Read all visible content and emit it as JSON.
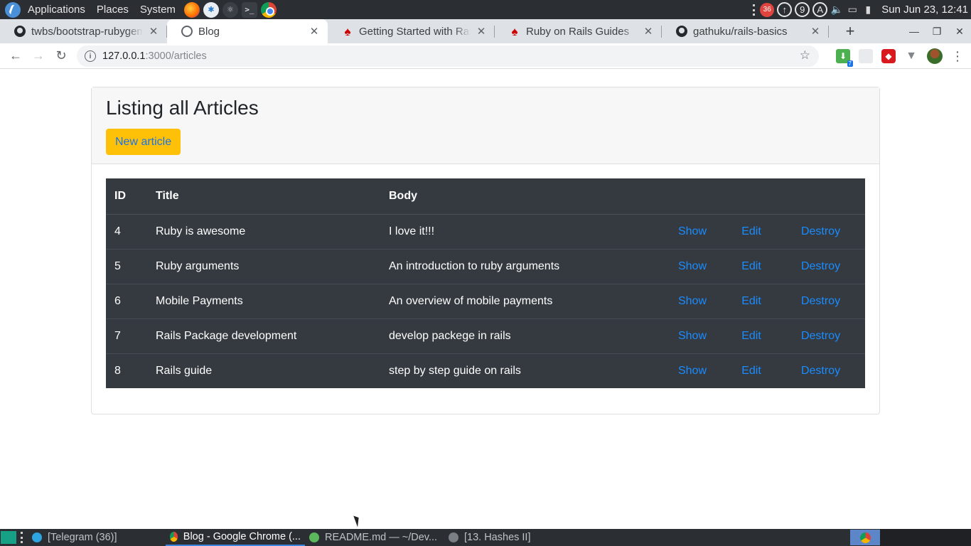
{
  "system_panel": {
    "menu": [
      "Applications",
      "Places",
      "System"
    ],
    "tray": {
      "badge_count": "36",
      "updates_glyph": "↑",
      "workspace": "9",
      "keyboard_layout": "A",
      "clock": "Sun Jun 23, 12:41"
    }
  },
  "browser": {
    "tabs": [
      {
        "title": "twbs/bootstrap-rubygem",
        "icon": "github-icon"
      },
      {
        "title": "Blog",
        "icon": "globe-icon",
        "active": true
      },
      {
        "title": "Getting Started with Rails",
        "icon": "rails-icon"
      },
      {
        "title": "Ruby on Rails Guides",
        "icon": "rails-icon"
      },
      {
        "title": "gathuku/rails-basics",
        "icon": "github-icon"
      }
    ],
    "address": {
      "host": "127.0.0.1",
      "path": ":3000/articles"
    },
    "download_badge": "7"
  },
  "page": {
    "heading": "Listing all Articles",
    "new_article_label": "New article",
    "table": {
      "headers": {
        "id": "ID",
        "title": "Title",
        "body": "Body"
      },
      "action_labels": {
        "show": "Show",
        "edit": "Edit",
        "destroy": "Destroy"
      },
      "rows": [
        {
          "id": "4",
          "title": "Ruby is awesome",
          "body": "I love it!!!"
        },
        {
          "id": "5",
          "title": "Ruby arguments",
          "body": "An introduction to ruby arguments"
        },
        {
          "id": "6",
          "title": "Mobile Payments",
          "body": "An overview of mobile payments"
        },
        {
          "id": "7",
          "title": "Rails Package development",
          "body": "develop packege in rails"
        },
        {
          "id": "8",
          "title": "Rails guide",
          "body": "step by step guide on rails"
        }
      ]
    }
  },
  "taskbar": {
    "tasks": [
      {
        "label": "[Telegram (36)]"
      },
      {
        "label": "Blog - Google Chrome (..."
      },
      {
        "label": "README.md — ~/Dev..."
      },
      {
        "label": "[13. Hashes II]"
      }
    ]
  },
  "colors": {
    "table_bg": "#343a40",
    "link": "#1a8cff",
    "warning_button": "#ffc107",
    "panel_bg": "#2b2e33"
  }
}
